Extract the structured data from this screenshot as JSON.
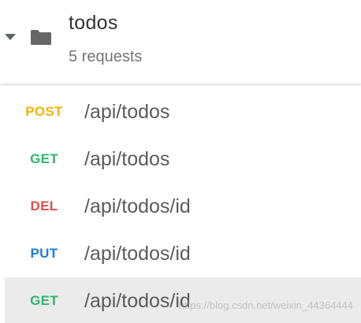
{
  "collection": {
    "name": "todos",
    "count_label": "5 requests",
    "icons": {
      "toggle": "caret-down-icon",
      "folder": "folder-icon"
    }
  },
  "requests": [
    {
      "method": "POST",
      "path": "/api/todos",
      "color": "#f5b400"
    },
    {
      "method": "GET",
      "path": "/api/todos",
      "color": "#2fb56b"
    },
    {
      "method": "DEL",
      "path": "/api/todos/id",
      "color": "#e74c4c"
    },
    {
      "method": "PUT",
      "path": "/api/todos/id",
      "color": "#1a7ee0"
    },
    {
      "method": "GET",
      "path": "/api/todos/id",
      "color": "#2fb56b",
      "selected": true
    }
  ],
  "watermark": "https://blog.csdn.net/weixin_44364444"
}
